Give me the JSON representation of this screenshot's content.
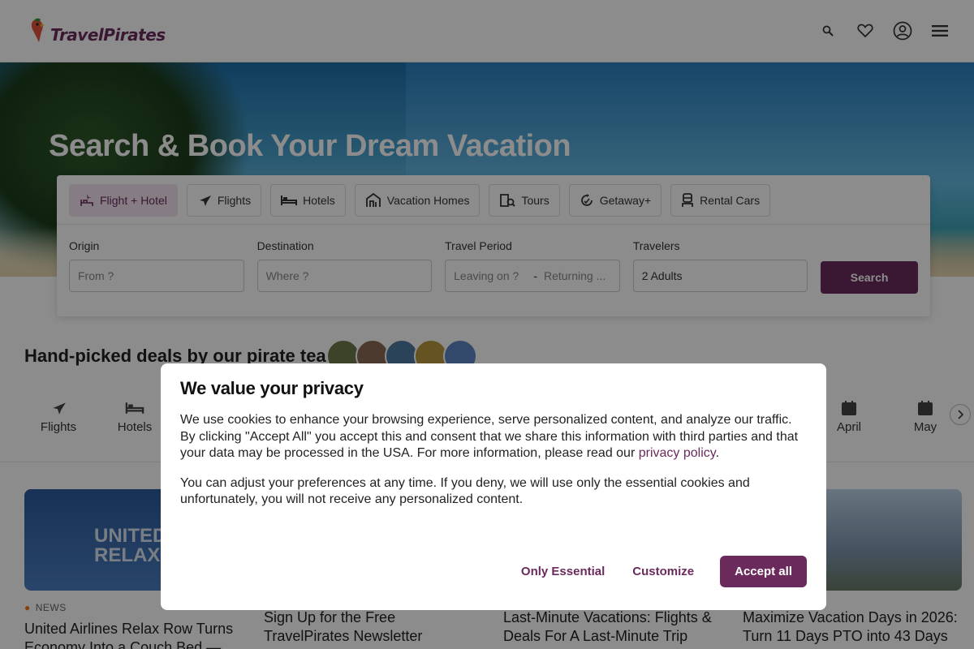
{
  "brand": {
    "name": "TravelPirates",
    "color": "#6b2a5c"
  },
  "header": {
    "icons": [
      "search-icon",
      "heart-icon",
      "account-icon",
      "menu-icon"
    ]
  },
  "hero": {
    "title": "Search & Book Your Dream Vacation"
  },
  "search": {
    "tabs": [
      {
        "label": "Flight + Hotel",
        "icon": "flight-hotel-icon",
        "active": true
      },
      {
        "label": "Flights",
        "icon": "plane-icon",
        "active": false
      },
      {
        "label": "Hotels",
        "icon": "bed-icon",
        "active": false
      },
      {
        "label": "Vacation Homes",
        "icon": "house-icon",
        "active": false
      },
      {
        "label": "Tours",
        "icon": "map-icon",
        "active": false
      },
      {
        "label": "Getaway+",
        "icon": "getaway-icon",
        "active": false
      },
      {
        "label": "Rental Cars",
        "icon": "car-icon",
        "active": false
      }
    ],
    "origin": {
      "label": "Origin",
      "placeholder": "From ?"
    },
    "destination": {
      "label": "Destination",
      "placeholder": "Where ?"
    },
    "period": {
      "label": "Travel Period",
      "leaving": "Leaving on ?",
      "separator": "-",
      "returning": "Returning ..."
    },
    "travelers": {
      "label": "Travelers",
      "value": "2 Adults"
    },
    "button": "Search"
  },
  "deals": {
    "title": "Hand-picked deals by our pirate team",
    "categories": [
      {
        "label": "Flights",
        "icon": "plane-icon"
      },
      {
        "label": "Hotels",
        "icon": "bed-icon"
      },
      {
        "label": "April",
        "icon": "calendar-icon"
      },
      {
        "label": "May",
        "icon": "calendar-icon"
      }
    ]
  },
  "cards": [
    {
      "tag": "NEWS",
      "title": "United Airlines Relax Row Turns Economy Into a Couch Bed —",
      "image_text": "UNITED RELAX RO"
    },
    {
      "tag": "",
      "title": "Sign Up for the Free TravelPirates Newsletter"
    },
    {
      "tag": "",
      "title": "Last-Minute Vacations: Flights & Deals For A Last-Minute Trip"
    },
    {
      "tag": "",
      "title": "Maximize Vacation Days in 2026: Turn 11 Days PTO into 43 Days"
    }
  ],
  "consent": {
    "title": "We value your privacy",
    "p1_before": "We use cookies to enhance your browsing experience, serve personalized content, and analyze our traffic. By clicking \"Accept All\" you accept this and consent that we share this information with third parties and that your data may be processed in the USA. For more information, please read our ",
    "p1_link": "privacy policy",
    "p1_after": ".",
    "p2": "You can adjust your preferences at any time. If you deny, we will use only the essential cookies and unfortunately, you will not receive any personalized content.",
    "buttons": {
      "essential": "Only Essential",
      "customize": "Customize",
      "accept": "Accept all"
    }
  }
}
